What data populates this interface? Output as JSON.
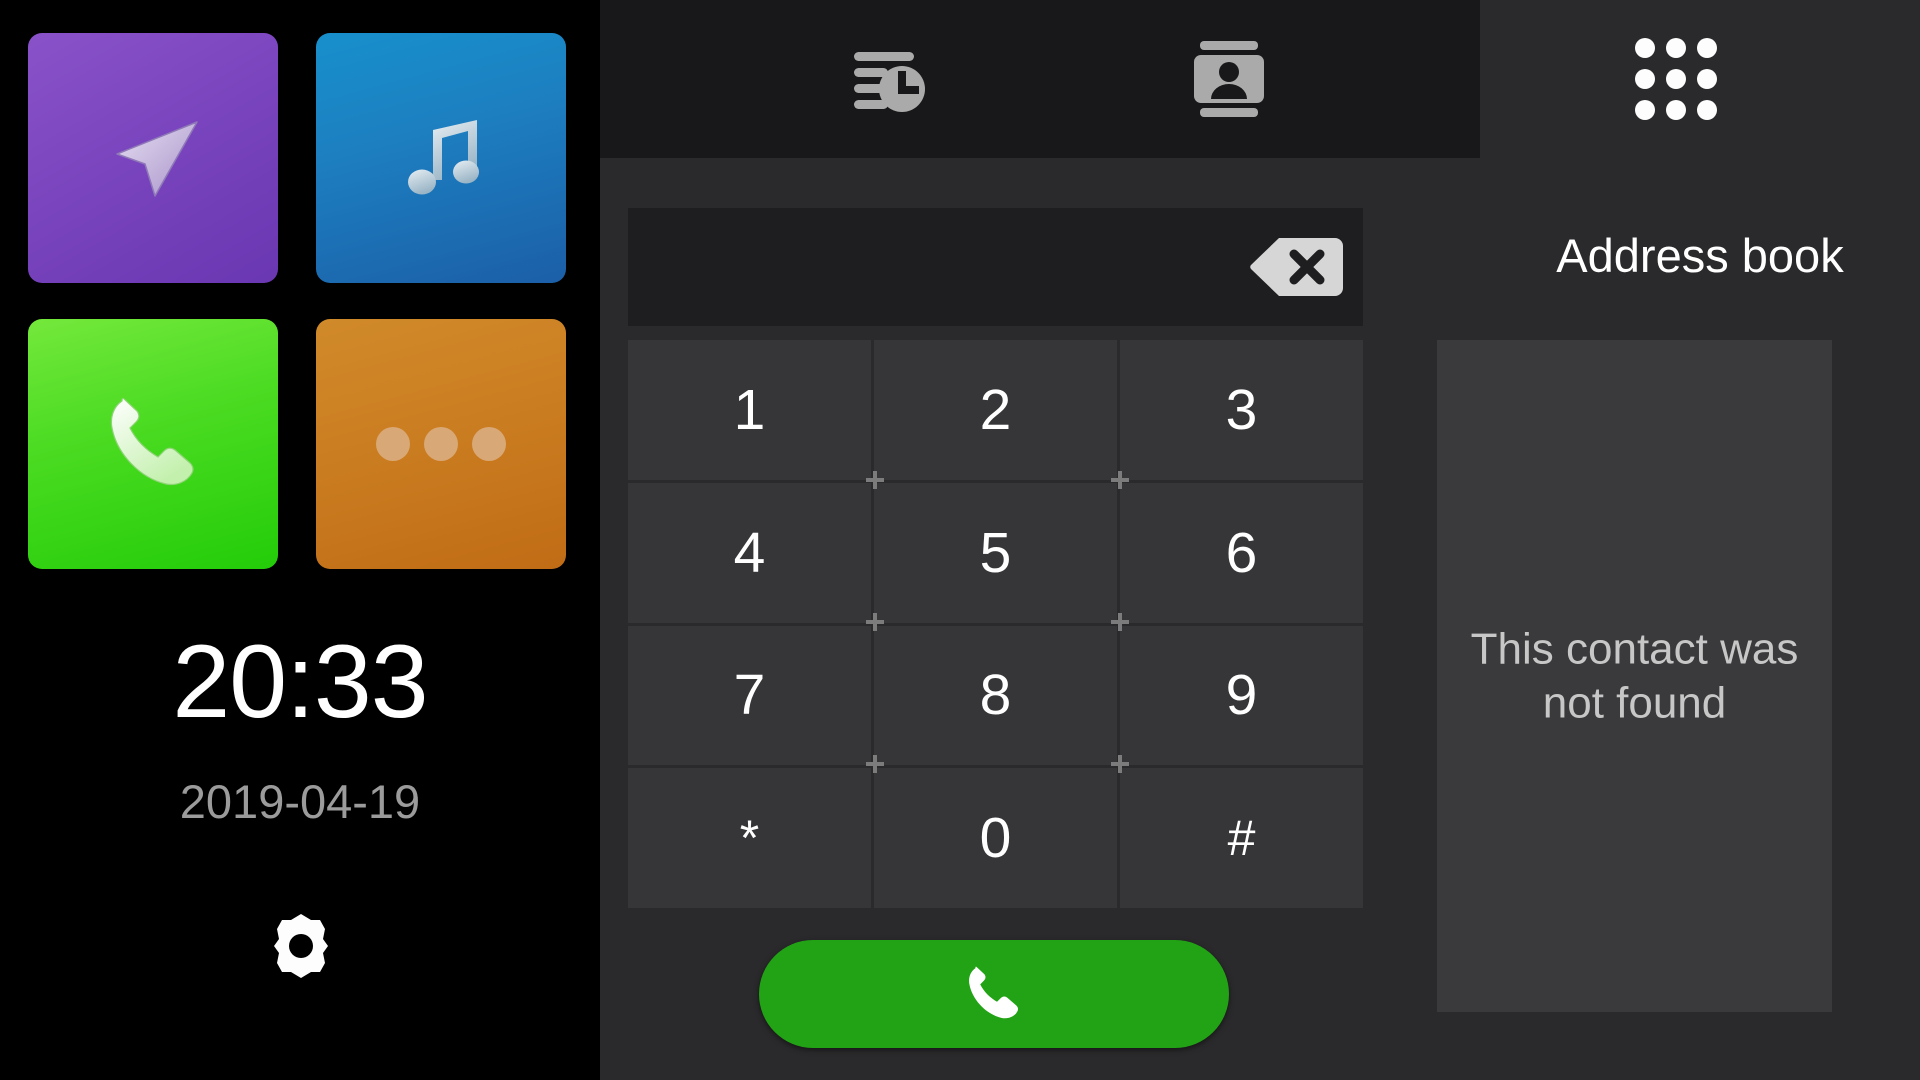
{
  "launcher": {
    "tiles": [
      {
        "name": "navigation",
        "icon": "navigation-arrow-icon",
        "color": "#7a45be"
      },
      {
        "name": "music",
        "icon": "music-note-icon",
        "color": "#1d7fc0"
      },
      {
        "name": "phone",
        "icon": "phone-handset-icon",
        "color": "#4ddc23"
      },
      {
        "name": "more",
        "icon": "more-dots-icon",
        "color": "#cc7f22"
      }
    ],
    "clock": {
      "time": "20:33",
      "date": "2019-04-19"
    },
    "settings": {
      "icon": "gear-icon",
      "label": "Settings"
    }
  },
  "tabbar": {
    "tabs": [
      {
        "id": "call-history",
        "icon": "call-history-icon",
        "label": "Call history"
      },
      {
        "id": "contacts",
        "icon": "contacts-card-icon",
        "label": "Contacts"
      }
    ],
    "app_drawer": {
      "icon": "grid-apps-icon",
      "label": "All apps"
    }
  },
  "dialer": {
    "number_field": {
      "value": "",
      "placeholder": ""
    },
    "backspace": {
      "icon": "backspace-icon",
      "label": "Backspace"
    },
    "keys": [
      {
        "label": "1"
      },
      {
        "label": "2"
      },
      {
        "label": "3"
      },
      {
        "label": "4"
      },
      {
        "label": "5"
      },
      {
        "label": "6"
      },
      {
        "label": "7"
      },
      {
        "label": "8"
      },
      {
        "label": "9"
      },
      {
        "label": "*"
      },
      {
        "label": "0"
      },
      {
        "label": "#"
      }
    ],
    "call_button": {
      "icon": "phone-handset-icon",
      "label": "Call",
      "color": "#22a315"
    }
  },
  "address_book": {
    "title": "Address book",
    "empty_message": "This contact was not found"
  },
  "colors": {
    "page_bg": "#2a2a2c",
    "launcher_bg": "#000000",
    "tabbar_bg": "#18181a",
    "key_bg": "#363638",
    "field_bg": "#1e1e20",
    "card_bg": "#3a3a3c",
    "call_green": "#22a315",
    "text_primary": "#ffffff",
    "text_muted": "#9b9b9b"
  }
}
